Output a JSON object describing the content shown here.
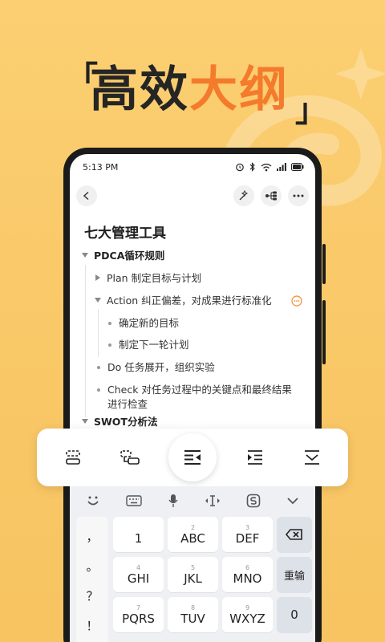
{
  "headline": {
    "open_bracket": "「",
    "close_bracket": "」",
    "part1": "高效",
    "part2": "大纲",
    "dark_color": "#252525",
    "accent_color": "#f47a2c"
  },
  "status_bar": {
    "time": "5:13 PM"
  },
  "toolbar": {
    "back_icon": "chevron-left-icon",
    "icons": [
      "magic-wand-icon",
      "mindmap-icon",
      "more-icon"
    ]
  },
  "document": {
    "title": "七大管理工具",
    "items": [
      {
        "text": "PDCA循环规则",
        "level": 0,
        "marker": "expanded",
        "bold": true
      },
      {
        "text": "Plan 制定目标与计划",
        "level": 1,
        "marker": "collapsed"
      },
      {
        "text": "Action 纠正偏差，对成果进行标准化",
        "level": 1,
        "marker": "expanded",
        "has_comment": true
      },
      {
        "text": "确定新的目标",
        "level": 2,
        "marker": "bullet"
      },
      {
        "text": "制定下一轮计划",
        "level": 2,
        "marker": "bullet"
      },
      {
        "text": "Do 任务展开，组织实验",
        "level": 1,
        "marker": "bullet"
      },
      {
        "text": "Check 对任务过程中的关键点和最终结果",
        "text2": "进行检查",
        "level": 1,
        "marker": "bullet"
      },
      {
        "text": "SWOT分析法",
        "level": 0,
        "marker": "expanded",
        "bold": true
      }
    ]
  },
  "floating_toolbar": {
    "buttons": [
      {
        "icon": "block-convert-icon",
        "active": false
      },
      {
        "icon": "block-link-icon",
        "active": false
      },
      {
        "icon": "outdent-icon",
        "active": true
      },
      {
        "icon": "indent-icon",
        "active": false
      },
      {
        "icon": "collapse-all-icon",
        "active": false
      }
    ]
  },
  "keyboard": {
    "top_icons": [
      "emoji-icon",
      "keyboard-icon",
      "mic-icon",
      "cursor-icon",
      "clipboard-icon",
      "chevron-down-icon"
    ],
    "side_keys": [
      "，",
      "。",
      "？",
      "！"
    ],
    "rows": [
      [
        {
          "main": "1",
          "sub": ""
        },
        {
          "main": "ABC",
          "sub": "2"
        },
        {
          "main": "DEF",
          "sub": "3"
        }
      ],
      [
        {
          "main": "GHI",
          "sub": "4"
        },
        {
          "main": "JKL",
          "sub": "5"
        },
        {
          "main": "MNO",
          "sub": "6"
        }
      ],
      [
        {
          "main": "PQRS",
          "sub": "7"
        },
        {
          "main": "TUV",
          "sub": "8"
        },
        {
          "main": "WXYZ",
          "sub": "9"
        }
      ]
    ],
    "backspace_icon": "backspace-icon",
    "retype": "重输",
    "zero": "0"
  }
}
